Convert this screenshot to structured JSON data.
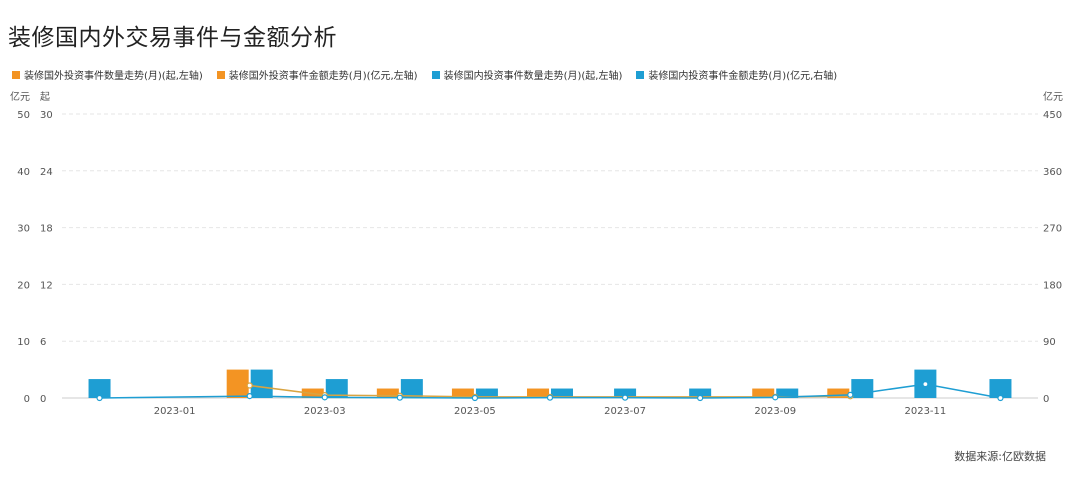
{
  "title": "装修国内外交易事件与金额分析",
  "source": "数据来源:亿欧数据",
  "colors": {
    "foreign": "#F39423",
    "domestic": "#1E9ED3"
  },
  "chart_data": {
    "type": "bar",
    "categories": [
      "2022-12",
      "2023-01",
      "2023-02",
      "2023-03",
      "2023-04",
      "2023-05",
      "2023-06",
      "2023-07",
      "2023-08",
      "2023-09",
      "2023-10",
      "2023-11",
      "2023-12"
    ],
    "x_tick_labels": [
      "2023-01",
      "2023-03",
      "2023-05",
      "2023-07",
      "2023-09",
      "2023-11"
    ],
    "axes": {
      "left_amount": {
        "unit": "亿元",
        "ticks": [
          0,
          10,
          20,
          30,
          40,
          50
        ],
        "range": [
          0,
          50
        ]
      },
      "left_count": {
        "unit": "起",
        "ticks": [
          0,
          6,
          12,
          18,
          24,
          30
        ],
        "range": [
          0,
          30
        ]
      },
      "right_amount": {
        "unit": "亿元",
        "ticks": [
          0,
          90,
          180,
          270,
          360,
          450
        ],
        "range": [
          0,
          450
        ]
      }
    },
    "grid": true,
    "legend_position": "top-left",
    "series": [
      {
        "name": "装修国外投资事件数量走势(月)(起,左轴)",
        "type": "bar",
        "axis": "left_count",
        "color": "#F39423",
        "values": [
          null,
          null,
          3,
          1,
          1,
          1,
          1,
          null,
          null,
          1,
          1,
          null,
          null
        ]
      },
      {
        "name": "装修国外投资事件金额走势(月)(亿元,左轴)",
        "type": "line",
        "axis": "left_amount",
        "color": "#D9A441",
        "values": [
          null,
          null,
          2.2,
          0.5,
          0.4,
          0.2,
          0.2,
          null,
          null,
          0.2,
          0.3,
          null,
          null
        ]
      },
      {
        "name": "装修国内投资事件数量走势(月)(起,左轴)",
        "type": "bar",
        "axis": "left_count",
        "color": "#1E9ED3",
        "values": [
          2,
          null,
          3,
          2,
          2,
          1,
          1,
          1,
          1,
          1,
          2,
          3,
          2
        ]
      },
      {
        "name": "装修国内投资事件金额走势(月)(亿元,右轴)",
        "type": "line",
        "axis": "right_amount",
        "color": "#1E9ED3",
        "values": [
          0,
          null,
          3,
          1,
          0.5,
          0,
          0.5,
          0.5,
          0,
          1,
          5,
          22,
          0
        ]
      }
    ]
  }
}
